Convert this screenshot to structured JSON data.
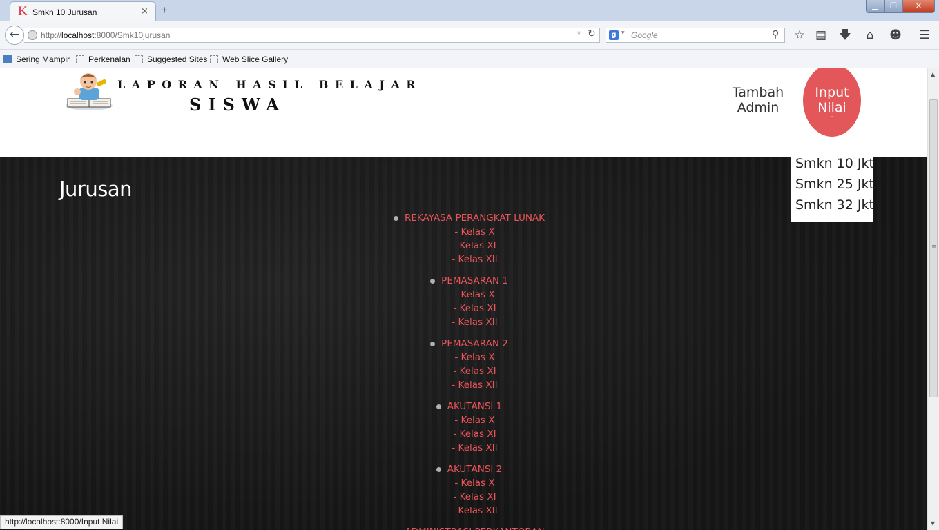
{
  "browser": {
    "tab_favicon": "K",
    "tab_title": "Smkn 10 Jurusan",
    "tab_close": "×",
    "new_tab": "+",
    "url_prefix": "http://",
    "url_host": "localhost",
    "url_rest": ":8000/Smk10jurusan",
    "search_engine_badge": "g",
    "search_placeholder": "Google",
    "window_buttons": {
      "minimize": "▁",
      "maximize": "❐",
      "close": "✕"
    },
    "bookmarks": [
      "Sering Mampir",
      "Perkenalan",
      "Suggested Sites",
      "Web Slice Gallery"
    ],
    "status_url": "http://localhost:8000/Input Nilai"
  },
  "site": {
    "title_line1": "LAPORAN HASIL BELAJAR",
    "title_line2": "SISWA",
    "nav": {
      "tambah_admin": "Tambah Admin",
      "input_nilai": "Input Nilai",
      "input_caret": "⌄"
    },
    "dropdown": [
      "Smkn 10 Jkt",
      "Smkn 25 Jkt",
      "Smkn 32 Jkt"
    ]
  },
  "main": {
    "heading": "Jurusan",
    "jurusan": [
      {
        "name": "REKAYASA PERANGKAT LUNAK",
        "kelas": [
          "- Kelas X",
          "- Kelas XI",
          "- Kelas XII"
        ]
      },
      {
        "name": "PEMASARAN 1",
        "kelas": [
          "- Kelas X",
          "- Kelas XI",
          "- Kelas XII"
        ]
      },
      {
        "name": "PEMASARAN 2",
        "kelas": [
          "- Kelas X",
          "- Kelas XI",
          "- Kelas XII"
        ]
      },
      {
        "name": "AKUTANSI 1",
        "kelas": [
          "- Kelas X",
          "- Kelas XI",
          "- Kelas XII"
        ]
      },
      {
        "name": "AKUTANSI 2",
        "kelas": [
          "- Kelas X",
          "- Kelas XI",
          "- Kelas XII"
        ]
      },
      {
        "name": "ADMINISTRASI PERKANTORAN",
        "kelas": []
      }
    ]
  },
  "colors": {
    "accent": "#e35659",
    "link": "#e9555a",
    "dark_bg": "#181818"
  },
  "icons": {
    "back": "back-arrow-icon",
    "reload": "reload-icon",
    "search": "magnifier-icon",
    "star": "bookmark-star-icon",
    "reader": "reading-list-icon",
    "download": "download-icon",
    "home": "home-icon",
    "chat": "chat-icon",
    "menu": "hamburger-menu-icon"
  }
}
